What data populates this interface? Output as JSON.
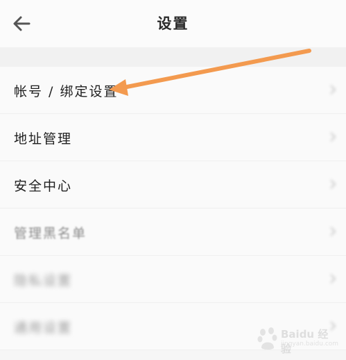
{
  "header": {
    "title": "设置",
    "back_icon": "back-arrow-icon"
  },
  "menu": {
    "items": [
      {
        "label": "帐号 / 绑定设置"
      },
      {
        "label": "地址管理"
      },
      {
        "label": "安全中心"
      },
      {
        "label": "管理黑名单"
      },
      {
        "label": "隐私设置"
      },
      {
        "label": "通用设置"
      }
    ]
  },
  "annotation": {
    "color": "#f39a4f"
  },
  "watermark": {
    "text": "Baidu 经验",
    "subtext": "jingyan.baidu.com"
  }
}
